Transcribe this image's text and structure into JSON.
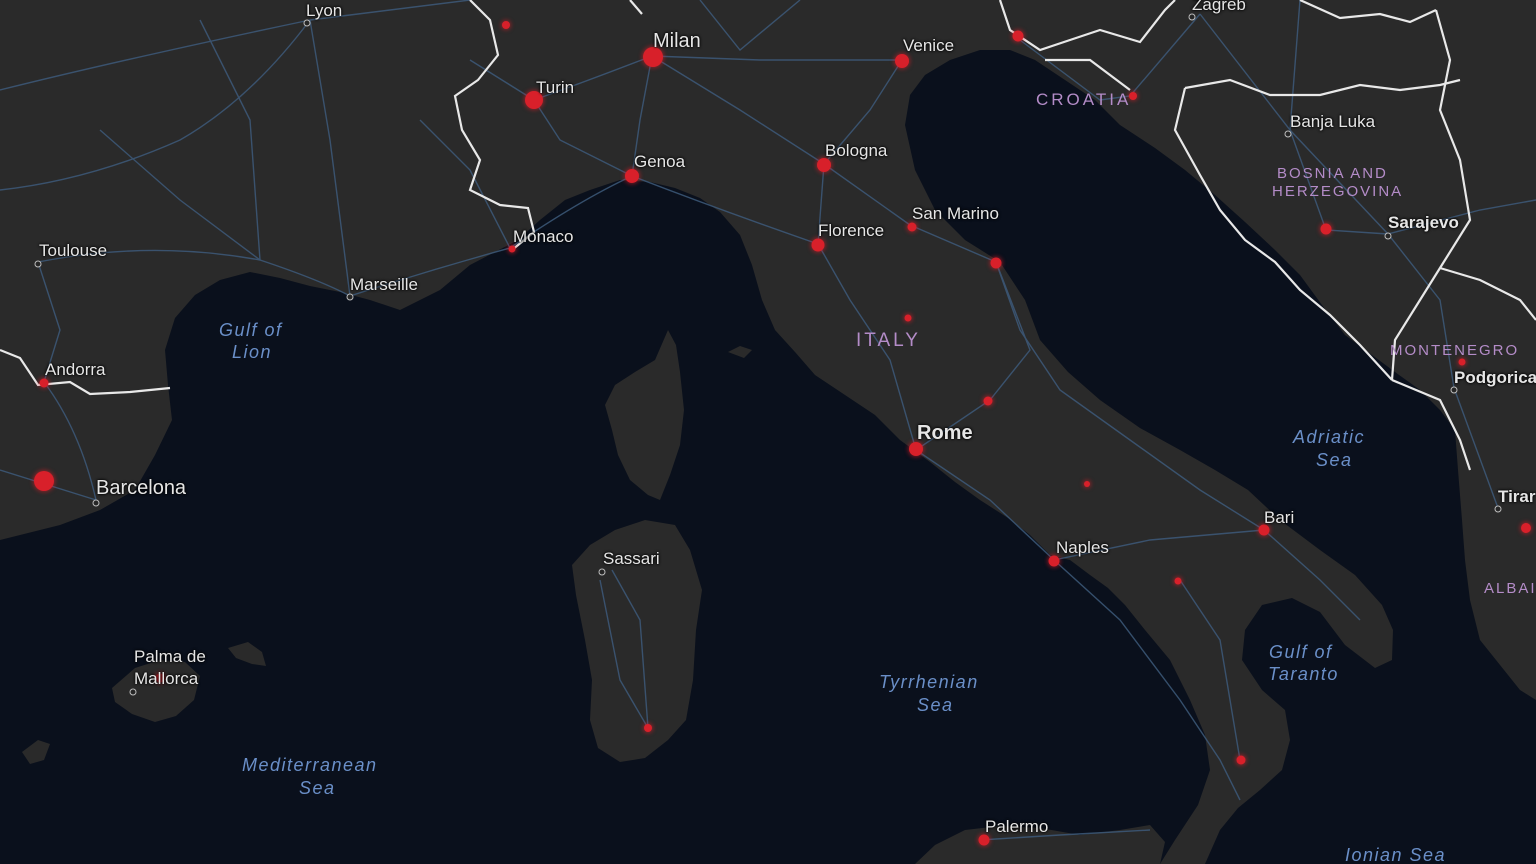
{
  "map": {
    "colors": {
      "water": "#0a101c",
      "land": "#2a2a2a",
      "roads": "#3d5a7a",
      "borders": "#e8e8e8",
      "hotspot": "#d8202a",
      "country_label": "#b48cc8",
      "sea_label": "#6a8fc8"
    },
    "cities": {
      "lyon": "Lyon",
      "milan": "Milan",
      "venice": "Venice",
      "zagreb": "Zagreb",
      "turin": "Turin",
      "genoa": "Genoa",
      "bologna": "Bologna",
      "banja_luka": "Banja Luka",
      "san_marino": "San Marino",
      "sarajevo": "Sarajevo",
      "monaco": "Monaco",
      "florence": "Florence",
      "toulouse": "Toulouse",
      "marseille": "Marseille",
      "andorra": "Andorra",
      "rome": "Rome",
      "podgorica": "Podgorica",
      "barcelona": "Barcelona",
      "tirana": "Tirar",
      "bari": "Bari",
      "naples": "Naples",
      "sassari": "Sassari",
      "palma_line1": "Palma de",
      "palma_line2": "Mallorca",
      "palermo": "Palermo"
    },
    "countries": {
      "croatia": "CROATIA",
      "bosnia_line1": "BOSNIA AND",
      "bosnia_line2": "HERZEGOVINA",
      "italy": "ITALY",
      "montenegro": "MONTENEGRO",
      "albania": "ALBAI"
    },
    "seas": {
      "gulf_lion_line1": "Gulf of",
      "gulf_lion_line2": "Lion",
      "adriatic_line1": "Adriatic",
      "adriatic_line2": "Sea",
      "gulf_taranto_line1": "Gulf of",
      "gulf_taranto_line2": "Taranto",
      "tyrrhenian_line1": "Tyrrhenian",
      "tyrrhenian_line2": "Sea",
      "mediterranean_line1": "Mediterranean",
      "mediterranean_line2": "Sea",
      "ionian": "Ionian Sea"
    }
  }
}
